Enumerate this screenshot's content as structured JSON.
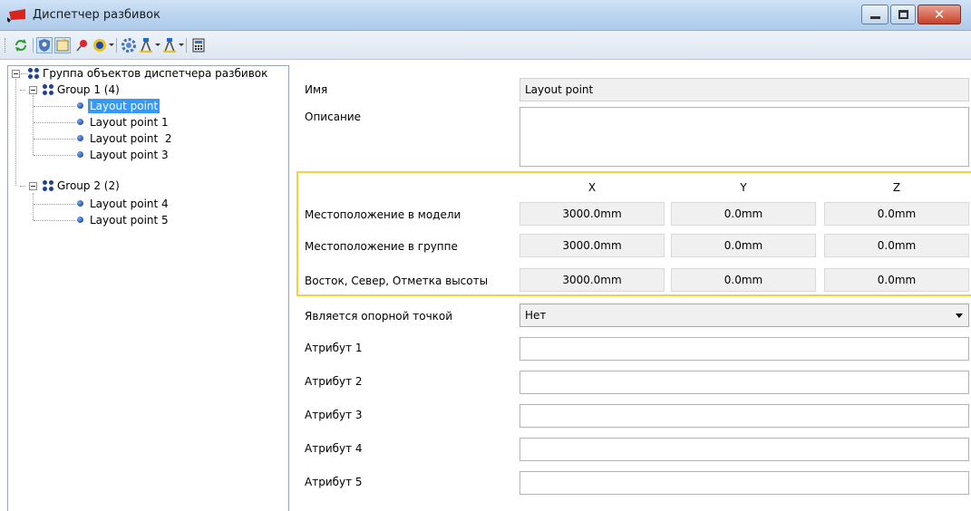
{
  "window": {
    "title": "Диспетчер разбивок",
    "close_glyph": "✕"
  },
  "toolbar": {
    "buttons": [
      "refresh-icon",
      "shield-icon",
      "note-icon",
      "pin-icon",
      "point-icon",
      "gear-icon",
      "survey-icon",
      "survey2-icon",
      "calculator-icon"
    ]
  },
  "tree": {
    "root": "Группа объектов диспетчера разбивок",
    "groups": [
      {
        "label": "Group 1 (4)",
        "points": [
          "Layout point",
          "Layout point 1",
          "Layout point  2",
          "Layout point 3"
        ]
      },
      {
        "label": "Group 2 (2)",
        "points": [
          "Layout point 4",
          "Layout point 5"
        ]
      }
    ],
    "selected": "Layout point"
  },
  "props": {
    "name_label": "Имя",
    "name_value": "Layout point",
    "description_label": "Описание",
    "description_value": "",
    "coords": {
      "headers": [
        "X",
        "Y",
        "Z"
      ],
      "rows": [
        {
          "label": "Местоположение в модели",
          "x": "3000.0mm",
          "y": "0.0mm",
          "z": "0.0mm"
        },
        {
          "label": "Местоположение в группе",
          "x": "3000.0mm",
          "y": "0.0mm",
          "z": "0.0mm"
        },
        {
          "label": "Восток, Север, Отметка высоты",
          "x": "3000.0mm",
          "y": "0.0mm",
          "z": "0.0mm"
        }
      ]
    },
    "base_point_label": "Является опорной точкой",
    "base_point_value": "Нет",
    "attributes": [
      {
        "label": "Атрибут 1",
        "value": ""
      },
      {
        "label": "Атрибут 2",
        "value": ""
      },
      {
        "label": "Атрибут 3",
        "value": ""
      },
      {
        "label": "Атрибут 4",
        "value": ""
      },
      {
        "label": "Атрибут 5",
        "value": ""
      }
    ]
  },
  "colors": {
    "highlight_border": "#f2d23b",
    "selection": "#3399ff",
    "titlebar": "#bcd5f0"
  }
}
